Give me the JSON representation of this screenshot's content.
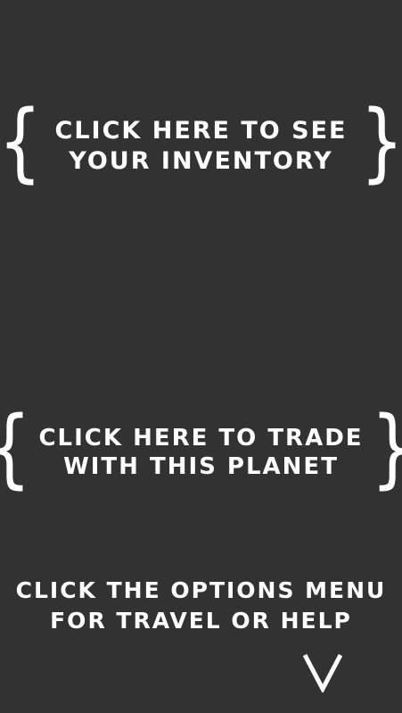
{
  "background": "#323232",
  "text_color": "#ffffff",
  "hints": {
    "inventory": {
      "line1": "CLICK HERE TO SEE",
      "line2": "YOUR INVENTORY",
      "left_brace": "{",
      "right_brace": "}"
    },
    "trade": {
      "line1": "CLICK HERE TO TRADE",
      "line2": "WITH THIS PLANET",
      "left_brace": "{",
      "right_brace": "}"
    },
    "options": {
      "line1": "CLICK THE OPTIONS MENU",
      "line2": "FOR TRAVEL OR HELP",
      "arrow_icon": "chevron-down-icon"
    }
  }
}
